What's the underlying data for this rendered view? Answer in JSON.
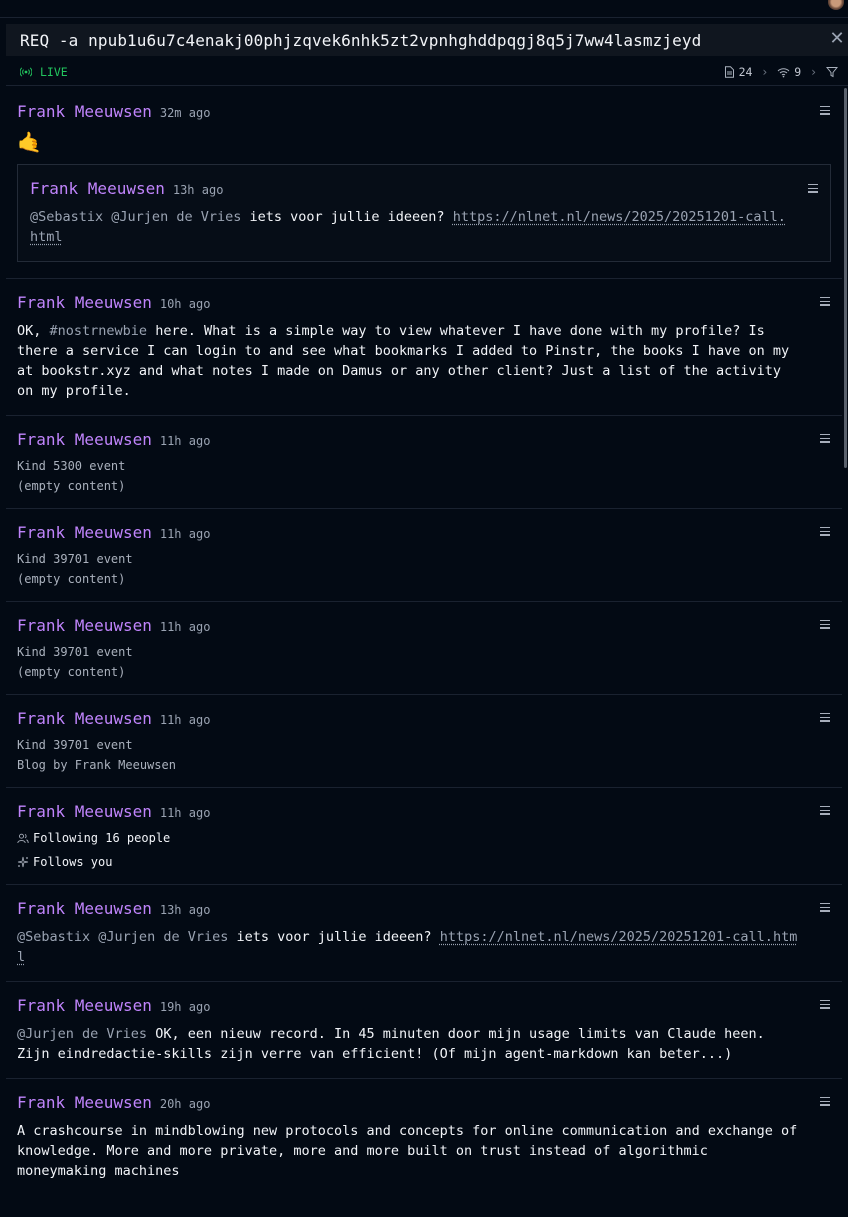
{
  "request": {
    "query": "REQ -a npub1u6u7c4enakj00phjzqvek6nhk5zt2vpnhghddpqgj8q5j7ww4lasmzjeyd"
  },
  "status": {
    "live_label": "LIVE",
    "events_count": "24",
    "relays_count": "9"
  },
  "notes": [
    {
      "author": "Frank Meeuwsen",
      "time": "32m ago",
      "emoji": "🤙",
      "quote": {
        "author": "Frank Meeuwsen",
        "time": "13h ago",
        "mention1": "@Sebastix",
        "mention2": "@Jurjen de Vries",
        "text": "iets voor jullie ideeen?",
        "link1": "https://nlnet.nl/news/2025/20251201-call.",
        "link2": "html"
      }
    },
    {
      "author": "Frank Meeuwsen",
      "time": "10h ago",
      "prefix": "OK,",
      "hashtag": "#nostrnewbie",
      "line1": "here. What is a simple way to view whatever I have done with my profile? Is",
      "line2": "there a service I can login to and see what bookmarks I added to Pinstr, the books I have on my",
      "line3": "at bookstr.xyz and what notes I made on Damus or any other client? Just a list of the activity",
      "line4": "on my profile."
    },
    {
      "author": "Frank Meeuwsen",
      "time": "11h ago",
      "kind": "Kind 5300 event",
      "content": "(empty content)"
    },
    {
      "author": "Frank Meeuwsen",
      "time": "11h ago",
      "kind": "Kind 39701 event",
      "content": "(empty content)"
    },
    {
      "author": "Frank Meeuwsen",
      "time": "11h ago",
      "kind": "Kind 39701 event",
      "content": "(empty content)"
    },
    {
      "author": "Frank Meeuwsen",
      "time": "11h ago",
      "kind": "Kind 39701 event",
      "content": "Blog by Frank Meeuwsen"
    },
    {
      "author": "Frank Meeuwsen",
      "time": "11h ago",
      "following": "Following 16 people",
      "follows_you": "Follows you"
    },
    {
      "author": "Frank Meeuwsen",
      "time": "13h ago",
      "mention1": "@Sebastix",
      "mention2": "@Jurjen de Vries",
      "text": "iets voor jullie ideeen?",
      "link1": "https://nlnet.nl/news/2025/20251201-call.htm",
      "link2": "l"
    },
    {
      "author": "Frank Meeuwsen",
      "time": "19h ago",
      "mention": "@Jurjen de Vries",
      "line1": "OK, een nieuw record. In 45 minuten door mijn usage limits van Claude heen.",
      "line2": "Zijn eindredactie-skills zijn verre van efficient! (Of mijn agent-markdown kan beter...)"
    },
    {
      "author": "Frank Meeuwsen",
      "time": "20h ago",
      "line1": "A crashcourse in mindblowing new protocols and concepts for online communication and exchange of",
      "line2": "knowledge. More and more private, more and more built on trust instead of algorithmic",
      "line3": "moneymaking machines"
    }
  ]
}
